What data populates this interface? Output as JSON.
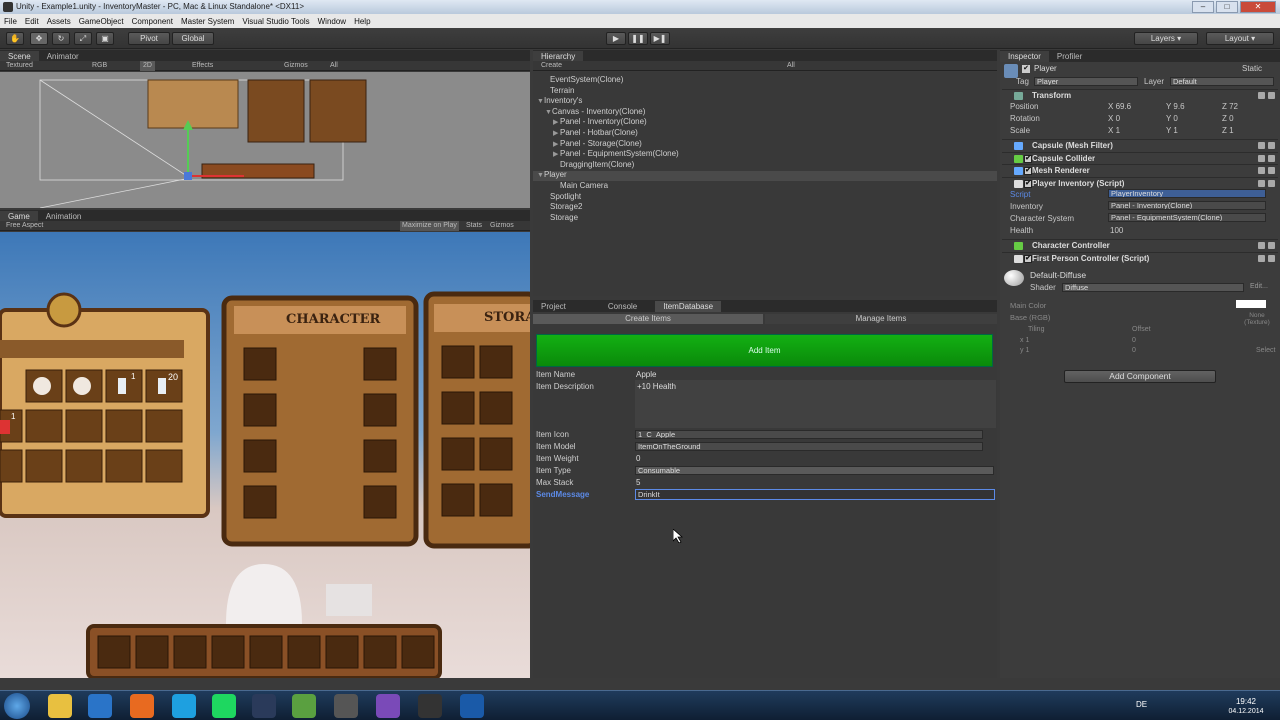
{
  "window": {
    "title": "Unity - Example1.unity - InventoryMaster - PC, Mac & Linux Standalone* <DX11>"
  },
  "menu": [
    "File",
    "Edit",
    "Assets",
    "GameObject",
    "Component",
    "Master System",
    "Visual Studio Tools",
    "Window",
    "Help"
  ],
  "toolbar": {
    "pivot": "Pivot",
    "global": "Global",
    "layers": "Layers",
    "layout": "Layout"
  },
  "scene": {
    "tab_scene": "Scene",
    "tab_animator": "Animator",
    "shading": "Textured",
    "rgb": "RGB",
    "mode2d": "2D",
    "effects": "Effects",
    "gizmos": "Gizmos",
    "all": "All"
  },
  "game": {
    "tab_game": "Game",
    "tab_animation": "Animation",
    "aspect": "Free Aspect",
    "maximize": "Maximize on Play",
    "stats": "Stats",
    "gizmos": "Gizmos",
    "character_title": "CHARACTER",
    "storage_title": "STORA",
    "slot_counts": {
      "bottle1": "1",
      "bottle20": "20",
      "potion": "1"
    }
  },
  "hierarchy": {
    "tab": "Hierarchy",
    "create": "Create",
    "search": "All",
    "items": [
      {
        "label": "EventSystem(Clone)"
      },
      {
        "label": "Terrain"
      },
      {
        "label": "Inventory's"
      },
      {
        "label": "Canvas - Inventory(Clone)"
      },
      {
        "label": "Panel - Inventory(Clone)"
      },
      {
        "label": "Panel - Hotbar(Clone)"
      },
      {
        "label": "Panel - Storage(Clone)"
      },
      {
        "label": "Panel - EquipmentSystem(Clone)"
      },
      {
        "label": "DraggingItem(Clone)"
      },
      {
        "label": "Player"
      },
      {
        "label": "Main Camera"
      },
      {
        "label": "Spotlight"
      },
      {
        "label": "Storage2"
      },
      {
        "label": "Storage"
      }
    ]
  },
  "itemdb": {
    "tab_project": "Project",
    "tab_console": "Console",
    "tab_itemdb": "ItemDatabase",
    "tab_create": "Create Items",
    "tab_manage": "Manage Items",
    "add_item": "Add Item",
    "fields": {
      "name_label": "Item Name",
      "name": "Apple",
      "desc_label": "Item Description",
      "desc": "+10 Health",
      "icon_label": "Item Icon",
      "icon": "1_C_Apple",
      "model_label": "Item Model",
      "model": "ItemOnTheGround",
      "weight_label": "Item Weight",
      "weight": "0",
      "type_label": "Item Type",
      "type": "Consumable",
      "stack_label": "Max Stack",
      "stack": "5",
      "send_label": "SendMessage",
      "send": "DrinkIt"
    }
  },
  "inspector": {
    "tab": "Inspector",
    "profiler": "Profiler",
    "object": "Player",
    "static": "Static",
    "tag_label": "Tag",
    "tag": "Player",
    "layer_label": "Layer",
    "layer": "Default",
    "transform": "Transform",
    "position": {
      "label": "Position",
      "x": "69.6",
      "y": "9.6",
      "z": "72"
    },
    "rotation": {
      "label": "Rotation",
      "x": "0",
      "y": "0",
      "z": "0"
    },
    "scale": {
      "label": "Scale",
      "x": "1",
      "y": "1",
      "z": "1"
    },
    "comps": [
      "Capsule (Mesh Filter)",
      "Capsule Collider",
      "Mesh Renderer",
      "Player Inventory (Script)"
    ],
    "script_label": "Script",
    "script": "PlayerInventory",
    "inv_label": "Inventory",
    "inv": "Panel - Inventory(Clone)",
    "cs_label": "Character System",
    "cs": "Panel - EquipmentSystem(Clone)",
    "health_label": "Health",
    "health": "100",
    "comps2": [
      "Character Controller",
      "First Person Controller (Script)"
    ],
    "material": "Default-Diffuse",
    "shader_label": "Shader",
    "shader": "Diffuse",
    "edit": "Edit...",
    "main_color": "Main Color",
    "base": "Base (RGB)",
    "tiling": "Tiling",
    "offset": "Offset",
    "none_tex": "None (Texture)",
    "select": "Select",
    "add_component": "Add Component"
  },
  "clock": {
    "lang": "DE",
    "time": "19:42",
    "date": "04.12.2014"
  },
  "colors": {
    "accent_green": "#0e9a0e",
    "selection_blue": "#3e5f96",
    "highlight_text": "#5c8ae6"
  }
}
